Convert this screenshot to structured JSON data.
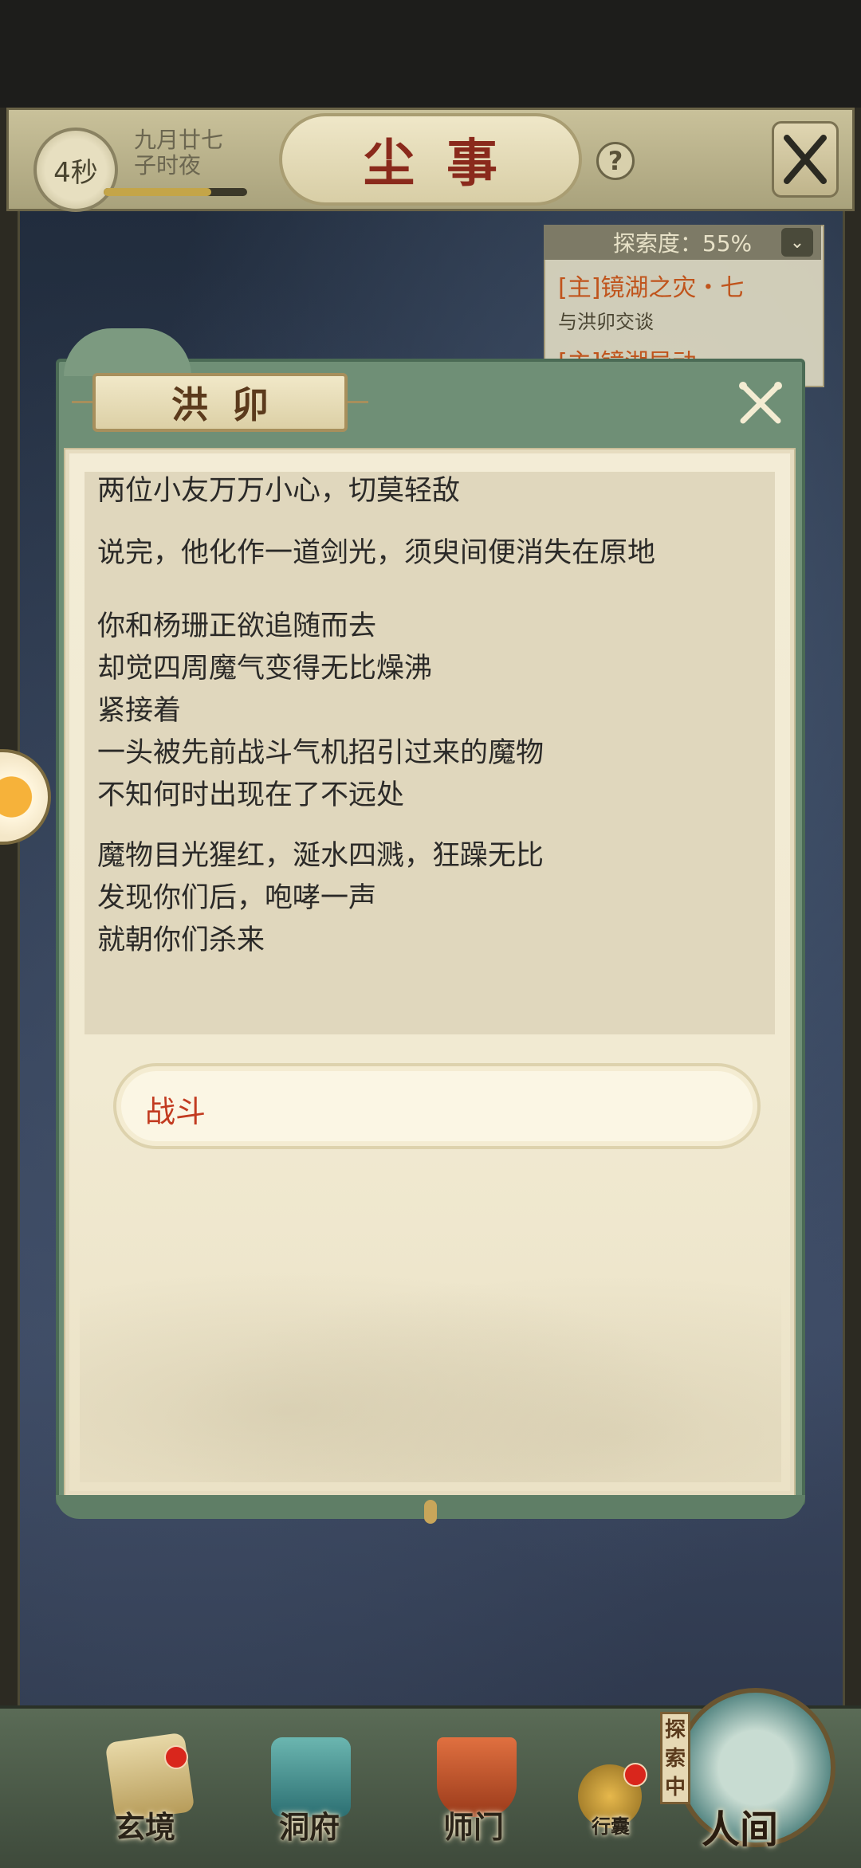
{
  "header": {
    "timer": "4秒",
    "date_line1": "九月廿七",
    "date_line2": "子时夜",
    "title": "尘事",
    "help": "?"
  },
  "quest_panel": {
    "progress": "探索度：55%",
    "quest1_title": "[主]镜湖之灾・七",
    "quest1_sub": "与洪卯交谈",
    "quest2_title": "[主]镜湖异动"
  },
  "dialog": {
    "speaker": "洪卯",
    "paragraphs": [
      [
        "两位小友万万小心，切莫轻敌"
      ],
      [
        "说完，他化作一道剑光，须臾间便消失在原地"
      ],
      [
        "你和杨珊正欲追随而去",
        "却觉四周魔气变得无比燥沸",
        "紧接着",
        "一头被先前战斗气机招引过来的魔物",
        "不知何时出现在了不远处"
      ],
      [
        "魔物目光猩红，涎水四溅，狂躁无比",
        "发现你们后，咆哮一声",
        "就朝你们杀来"
      ]
    ],
    "options": [
      "战斗"
    ]
  },
  "bottom_nav": {
    "items": [
      "玄境",
      "洞府",
      "师门",
      "行囊"
    ],
    "badges": {
      "xuanjing": true,
      "xingnang": true
    },
    "explore_tag": "探索中",
    "main": "人间"
  },
  "colors": {
    "dialog_frame": "#6f8f76",
    "paper": "#f3ecd6",
    "option_text": "#c23b20",
    "title_text": "#8a2a1c",
    "quest_text": "#c0541c"
  },
  "icons": [
    "help-icon",
    "close-icon",
    "dialog-close-icon",
    "scroll-icon",
    "pavilion-icon",
    "banner-icon",
    "pouch-icon",
    "globe-icon"
  ]
}
